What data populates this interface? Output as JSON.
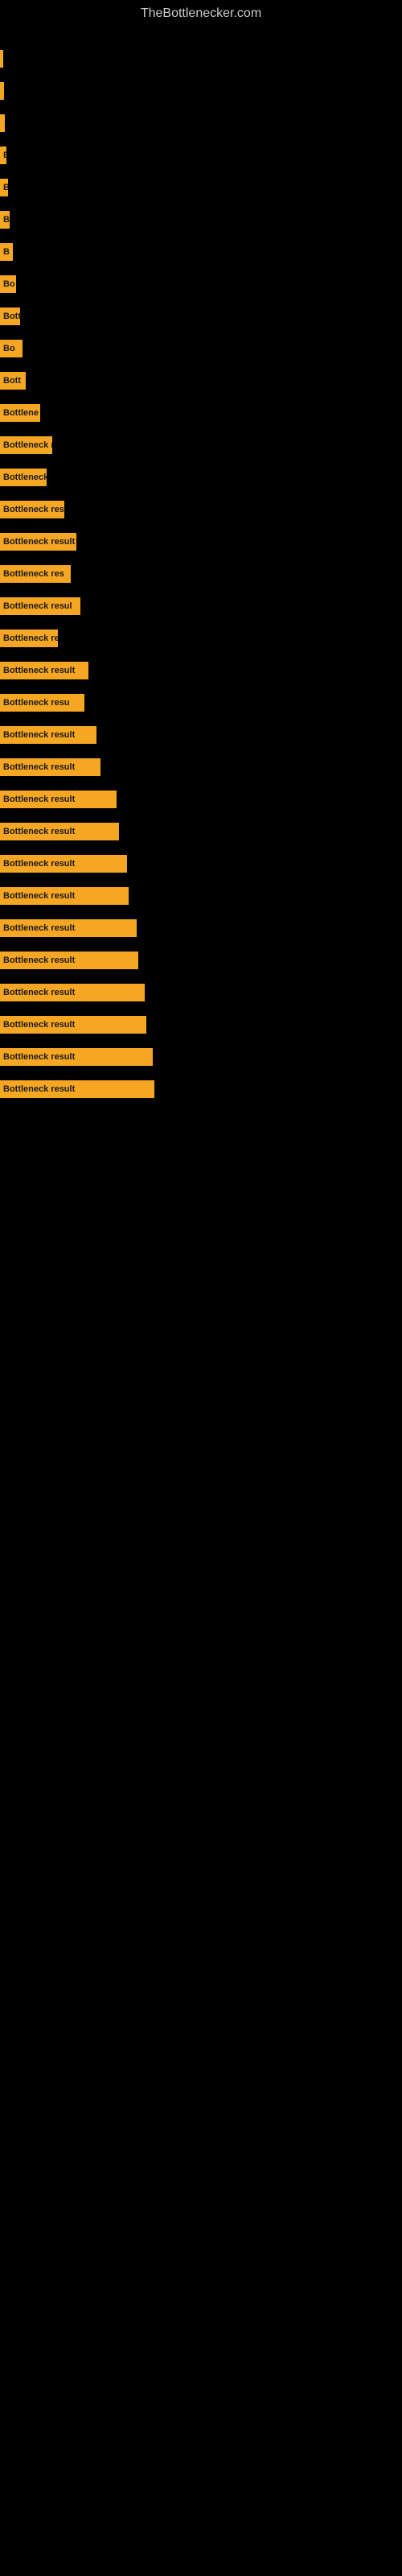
{
  "site": {
    "title": "TheBottlenecker.com"
  },
  "bars": [
    {
      "id": 1,
      "width": 4,
      "label": ""
    },
    {
      "id": 2,
      "width": 5,
      "label": ""
    },
    {
      "id": 3,
      "width": 6,
      "label": ""
    },
    {
      "id": 4,
      "width": 8,
      "label": "B"
    },
    {
      "id": 5,
      "width": 10,
      "label": "B"
    },
    {
      "id": 6,
      "width": 12,
      "label": "B"
    },
    {
      "id": 7,
      "width": 16,
      "label": "B"
    },
    {
      "id": 8,
      "width": 20,
      "label": "Bo"
    },
    {
      "id": 9,
      "width": 25,
      "label": "Bott"
    },
    {
      "id": 10,
      "width": 28,
      "label": "Bo"
    },
    {
      "id": 11,
      "width": 32,
      "label": "Bott"
    },
    {
      "id": 12,
      "width": 50,
      "label": "Bottlene"
    },
    {
      "id": 13,
      "width": 65,
      "label": "Bottleneck re"
    },
    {
      "id": 14,
      "width": 58,
      "label": "Bottleneck"
    },
    {
      "id": 15,
      "width": 80,
      "label": "Bottleneck res"
    },
    {
      "id": 16,
      "width": 95,
      "label": "Bottleneck result"
    },
    {
      "id": 17,
      "width": 88,
      "label": "Bottleneck res"
    },
    {
      "id": 18,
      "width": 100,
      "label": "Bottleneck resul"
    },
    {
      "id": 19,
      "width": 72,
      "label": "Bottleneck re"
    },
    {
      "id": 20,
      "width": 110,
      "label": "Bottleneck result"
    },
    {
      "id": 21,
      "width": 105,
      "label": "Bottleneck resu"
    },
    {
      "id": 22,
      "width": 120,
      "label": "Bottleneck result"
    },
    {
      "id": 23,
      "width": 125,
      "label": "Bottleneck result"
    },
    {
      "id": 24,
      "width": 145,
      "label": "Bottleneck result"
    },
    {
      "id": 25,
      "width": 148,
      "label": "Bottleneck result"
    },
    {
      "id": 26,
      "width": 158,
      "label": "Bottleneck result"
    },
    {
      "id": 27,
      "width": 160,
      "label": "Bottleneck result"
    },
    {
      "id": 28,
      "width": 170,
      "label": "Bottleneck result"
    },
    {
      "id": 29,
      "width": 172,
      "label": "Bottleneck result"
    },
    {
      "id": 30,
      "width": 180,
      "label": "Bottleneck result"
    },
    {
      "id": 31,
      "width": 182,
      "label": "Bottleneck result"
    },
    {
      "id": 32,
      "width": 190,
      "label": "Bottleneck result"
    },
    {
      "id": 33,
      "width": 192,
      "label": "Bottleneck result"
    }
  ]
}
